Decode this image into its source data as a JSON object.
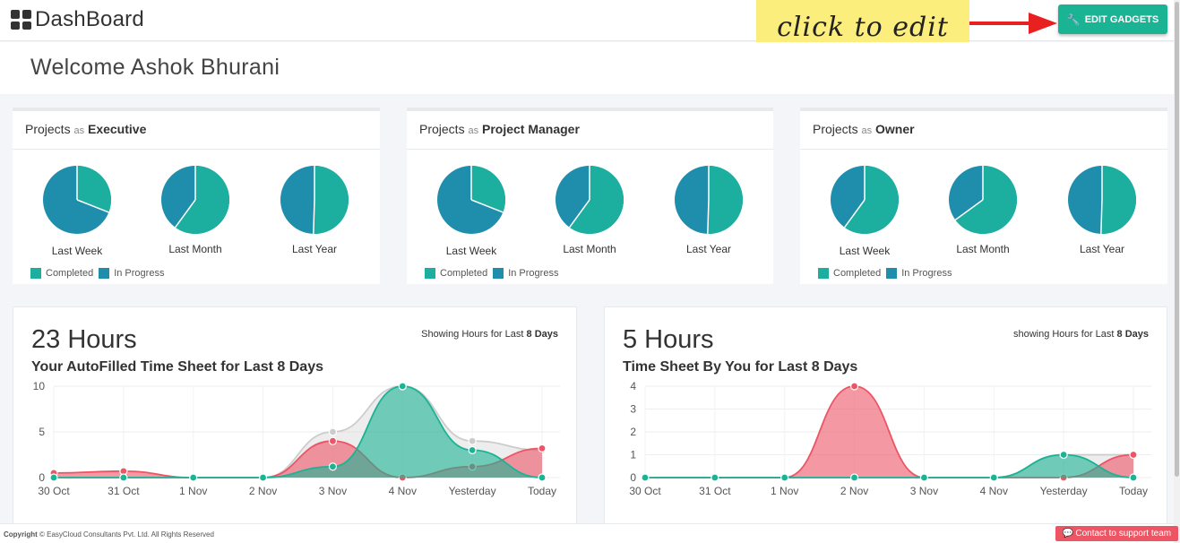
{
  "header": {
    "title": "DashBoard",
    "sticky_note": "click to edit",
    "edit_button": "EDIT GADGETS"
  },
  "welcome": "Welcome Ashok Bhurani",
  "colors": {
    "completed": "#1cae9e",
    "in_progress": "#1f8dac",
    "accent": "#1ab394",
    "red": "#ed5565"
  },
  "project_panels": [
    {
      "prefix": "Projects",
      "as": "as",
      "role": "Executive",
      "pies": [
        {
          "label": "Last Week",
          "completed": 0.31
        },
        {
          "label": "Last Month",
          "completed": 0.6
        },
        {
          "label": "Last Year",
          "completed": 0.505
        }
      ]
    },
    {
      "prefix": "Projects",
      "as": "as",
      "role": "Project Manager",
      "pies": [
        {
          "label": "Last Week",
          "completed": 0.31
        },
        {
          "label": "Last Month",
          "completed": 0.6
        },
        {
          "label": "Last Year",
          "completed": 0.505
        }
      ]
    },
    {
      "prefix": "Projects",
      "as": "as",
      "role": "Owner",
      "pies": [
        {
          "label": "Last Week",
          "completed": 0.6
        },
        {
          "label": "Last Month",
          "completed": 0.65
        },
        {
          "label": "Last Year",
          "completed": 0.505
        }
      ]
    }
  ],
  "legend": {
    "completed": "Completed",
    "in_progress": "In Progress"
  },
  "hour_panels": [
    {
      "hours": "23 Hours",
      "subtitle": "Your AutoFilled Time Sheet for Last 8 Days",
      "showing_prefix": "Showing Hours for Last",
      "showing_days": "8 Days"
    },
    {
      "hours": "5 Hours",
      "subtitle": "Time Sheet By You for Last 8 Days",
      "showing_prefix": "showing Hours for Last",
      "showing_days": "8 Days"
    }
  ],
  "chart_data": [
    {
      "type": "area",
      "categories": [
        "30 Oct",
        "31 Oct",
        "1 Nov",
        "2 Nov",
        "3 Nov",
        "4 Nov",
        "Yesterday",
        "Today"
      ],
      "yticks": [
        0,
        5,
        10
      ],
      "ylim": [
        0,
        10
      ],
      "series": [
        {
          "values": [
            0,
            0,
            0,
            0,
            5,
            10,
            4,
            3
          ],
          "color": "#cccccc"
        },
        {
          "values": [
            0.5,
            0.7,
            0,
            0,
            4,
            0,
            1.2,
            3.2
          ],
          "color": "#ed5565"
        },
        {
          "values": [
            0,
            0,
            0,
            0,
            1.2,
            10,
            3,
            0
          ],
          "color": "#1ab394"
        }
      ]
    },
    {
      "type": "area",
      "categories": [
        "30 Oct",
        "31 Oct",
        "1 Nov",
        "2 Nov",
        "3 Nov",
        "4 Nov",
        "Yesterday",
        "Today"
      ],
      "yticks": [
        0,
        1,
        2,
        3,
        4
      ],
      "ylim": [
        0,
        4
      ],
      "series": [
        {
          "values": [
            0,
            0,
            0,
            0,
            0,
            0,
            1,
            1
          ],
          "color": "#cccccc"
        },
        {
          "values": [
            0,
            0,
            0,
            4,
            0,
            0,
            0,
            1
          ],
          "color": "#ed5565"
        },
        {
          "values": [
            0,
            0,
            0,
            0,
            0,
            0,
            1,
            0
          ],
          "color": "#1ab394"
        }
      ]
    }
  ],
  "footer": {
    "copyright_label": "Copyright",
    "copyright_text": "© EasyCloud Consultants Pvt. Ltd. All Rights Reserved",
    "support": "Contact to support team"
  }
}
